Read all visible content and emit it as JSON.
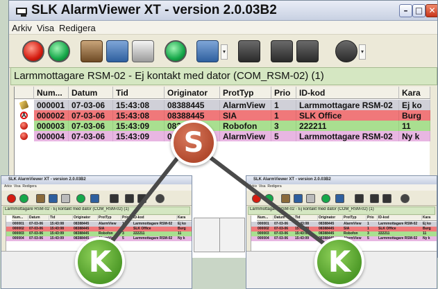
{
  "window": {
    "title": "SLK AlarmViewer XT - version 2.0.03B2",
    "minimize_glyph": "–",
    "maximize_glyph": "□",
    "close_glyph": "✕"
  },
  "menu": [
    "Arkiv",
    "Visa",
    "Redigera"
  ],
  "toolbar": {
    "icons": [
      "stop-red-icon",
      "go-green-icon",
      "books-icon",
      "transfer-icon",
      "printer-icon",
      "refresh-green-icon",
      "folder-image-icon",
      "dropdown-icon",
      "device-icon",
      "document-edit-icon",
      "graph-edit-icon",
      "clock-settings-icon",
      "dropdown-icon"
    ],
    "dropdown_glyph": "▾"
  },
  "info_bar": "Larmmottagare RSM-02  -  Ej kontakt med dator (COM_RSM-02) (1)",
  "table": {
    "columns": [
      "Num...",
      "Datum",
      "Tid",
      "Originator",
      "ProtTyp",
      "Prio",
      "ID-kod",
      "Kara"
    ],
    "rows": [
      {
        "num": "000001",
        "date": "07-03-06",
        "time": "15:43:08",
        "orig": "08388445",
        "prot": "AlarmView",
        "prio": "1",
        "id": "Larmmottagare RSM-02",
        "kara": "Ej ko",
        "color": "#d0d0d8",
        "icon": "edit-icon"
      },
      {
        "num": "000002",
        "date": "07-03-06",
        "time": "15:43:08",
        "orig": "08388445",
        "prot": "SIA",
        "prio": "1",
        "id": "SLK Office",
        "kara": "Burg",
        "color": "#f0787a",
        "icon": "alarm-a-icon"
      },
      {
        "num": "000003",
        "date": "07-03-06",
        "time": "15:43:09",
        "orig": "08388445",
        "prot": "Robofon",
        "prio": "3",
        "id": "222211",
        "kara": "11",
        "color": "#a9df90",
        "icon": "red-dot-icon"
      },
      {
        "num": "000004",
        "date": "07-03-06",
        "time": "15:43:09",
        "orig": "08388445",
        "prot": "AlarmView",
        "prio": "5",
        "id": "Larmmottagare RSM-02",
        "kara": "Ny k",
        "color": "#e8b6e2",
        "icon": "red-dot-icon"
      }
    ]
  },
  "badges": {
    "s": "S",
    "k_left": "K",
    "k_right": "K"
  },
  "colors": {
    "line": "#4a4a4a",
    "infobar": "#d5e7c2",
    "badge_s": "#b24a2e",
    "badge_k": "#4e9a28"
  }
}
